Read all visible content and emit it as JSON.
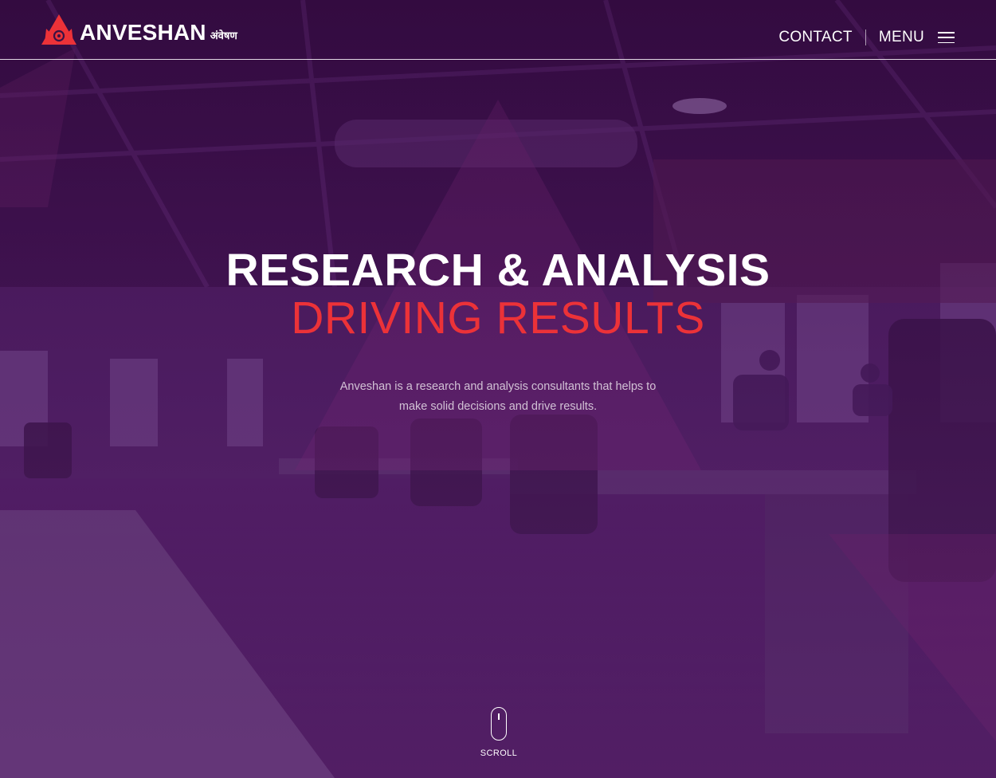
{
  "brand": {
    "name": "ANVESHAN",
    "sub": "अंवेषण",
    "accent_color": "#ec3238",
    "logo_icon": "triangle-logo-icon"
  },
  "nav": {
    "contact_label": "CONTACT",
    "menu_label": "MENU",
    "menu_icon": "hamburger-icon"
  },
  "hero": {
    "headline_line1": "RESEARCH & ANALYSIS",
    "headline_line2": "DRIVING RESULTS",
    "tagline": "Anveshan is a research and analysis consultants that helps to make solid decisions and drive results.",
    "background_tint": "#3a1245"
  },
  "scroll": {
    "label": "SCROLL",
    "icon": "mouse-scroll-icon"
  }
}
